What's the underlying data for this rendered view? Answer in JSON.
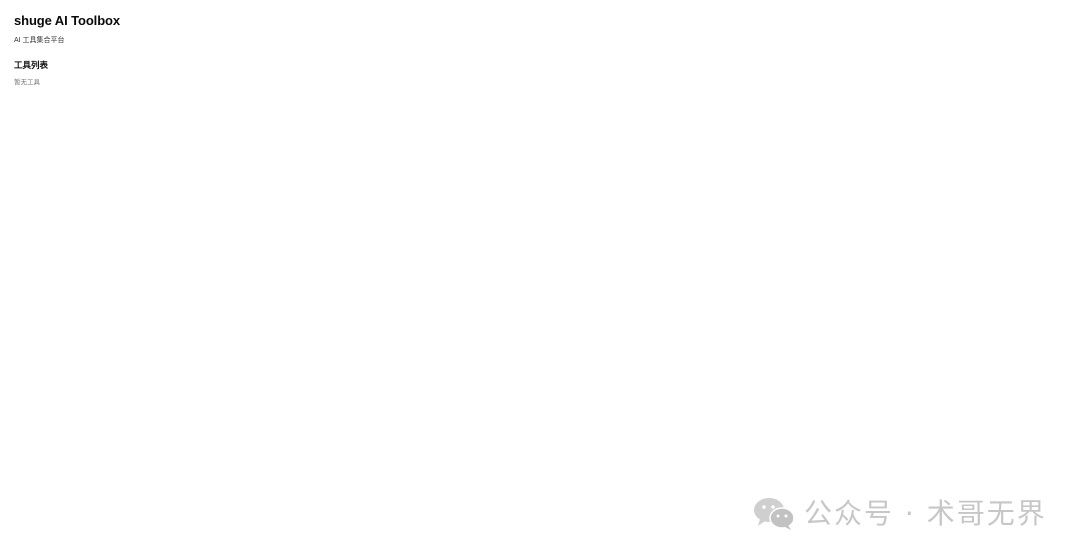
{
  "app": {
    "title": "shuge AI Toolbox",
    "subtitle": "AI 工具集合平台"
  },
  "tools_section": {
    "heading": "工具列表",
    "empty_message": "暂无工具"
  },
  "watermark": {
    "icon": "wechat-icon",
    "text": "公众号 · 术哥无界"
  }
}
